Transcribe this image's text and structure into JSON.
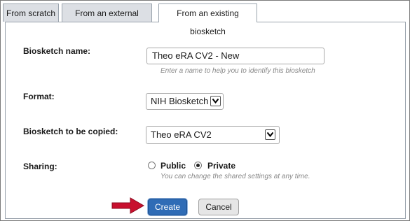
{
  "tabs": [
    {
      "label": "From scratch",
      "active": false
    },
    {
      "label": "From an external source",
      "active": false
    },
    {
      "label": "From an existing biosketch",
      "active": true
    }
  ],
  "form": {
    "name_label": "Biosketch name:",
    "name_value": "Theo eRA CV2 - New",
    "name_hint": "Enter a name to help you to identify this biosketch",
    "format_label": "Format:",
    "format_value": "NIH Biosketch",
    "copy_label": "Biosketch to be copied:",
    "copy_value": "Theo eRA CV2",
    "sharing_label": "Sharing:",
    "sharing_options": [
      "Public",
      "Private"
    ],
    "sharing_selected": "Private",
    "sharing_hint": "You can change the shared settings at any time."
  },
  "buttons": {
    "create_label": "Create",
    "cancel_label": "Cancel"
  },
  "colors": {
    "primary_button": "#2f6cb6",
    "arrow": "#c8102e"
  },
  "icons": {
    "dropdown": "chevron-down-icon",
    "pointer": "arrow-right-icon"
  }
}
